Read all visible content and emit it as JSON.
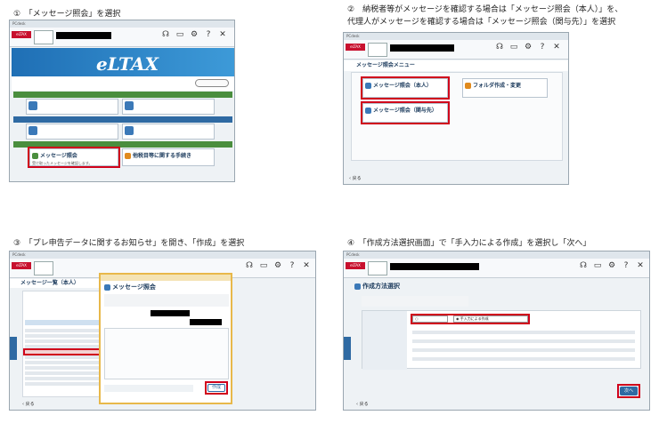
{
  "captions": {
    "c1_num": "①",
    "c1_text": "「メッセージ照会」を選択",
    "c2_num": "②",
    "c2_line1": "納税者等がメッセージを確認する場合は「メッセージ照会（本人）」を、",
    "c2_line2": "代理人がメッセージを確認する場合は「メッセージ照会（関与先）」を選択",
    "c3_num": "③",
    "c3_text": "「プレ申告データに関するお知らせ」を開き、「作成」を選択",
    "c4_num": "④",
    "c4_text": "「作成方法選択画面」で「手入力による作成」を選択し「次へ」"
  },
  "toolbar": {
    "icons": [
      "headset-icon",
      "monitor-icon",
      "gear-icon",
      "question-icon",
      "close-icon"
    ]
  },
  "s1": {
    "logo": "eLTAX",
    "items": {
      "message": "メッセージ照会",
      "message_desc": "受け取ったメッセージを確認します。",
      "other": "他税目等に関する手続き"
    }
  },
  "s2": {
    "title": "メッセージ照会メニュー",
    "self": "メッセージ照会（本人）",
    "client": "メッセージ照会（関与先）",
    "folder": "フォルダ作成・変更",
    "back": "戻る"
  },
  "s3": {
    "list_title": "メッセージ一覧（本人）",
    "dialog_title": "メッセージ照会",
    "create_button": "作成",
    "back": "戻る"
  },
  "s4": {
    "title": "作成方法選択",
    "option_manual": "手入力による作成",
    "next_button": "次へ",
    "back": "戻る"
  }
}
